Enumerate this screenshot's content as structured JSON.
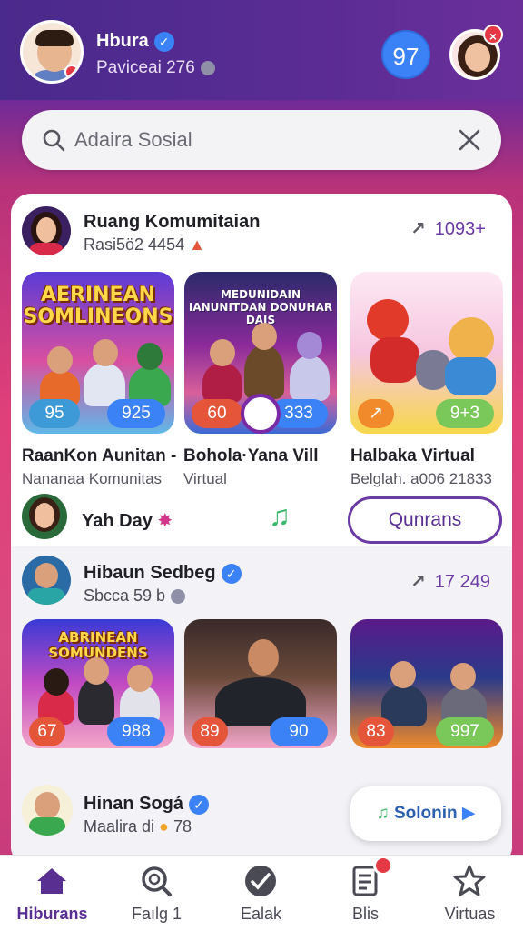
{
  "header": {
    "user_name": "Hbura",
    "user_sub": "Paviceai 276",
    "count_badge": "97"
  },
  "search": {
    "placeholder": "Adaira Sosial"
  },
  "group1": {
    "title": "Ruang Komumitaian",
    "sub": "Rasi5ö2 4454",
    "trend": "1093+",
    "tiles": [
      {
        "banner": "AERINEAN SOMLINEONS",
        "left_pill": "95",
        "right_pill": "925",
        "title": "RaanKon Aunitan -",
        "sub": "Nananaa Komunitas"
      },
      {
        "banner": "MEDUNIDAIN IANUNITDAN DONUHAR DAIS",
        "left_pill": "60",
        "right_pill": "333",
        "title": "Bohola·Yana Vill",
        "sub": "Virtual"
      },
      {
        "banner": "",
        "left_pill": "",
        "right_pill": "9+3",
        "title": "Halbaka Virtual",
        "sub": "Belglah. a006 21833"
      }
    ]
  },
  "row_yah": {
    "title": "Yah Day",
    "button": "Qunrans"
  },
  "group2": {
    "title": "Hibaun Sedbeg",
    "sub": "Sbcca 59 b",
    "trend": "17 249",
    "tiles": [
      {
        "banner": "ABRINEAN SOMUNDENS",
        "left_pill": "67",
        "right_pill": "988"
      },
      {
        "banner": "",
        "left_pill": "89",
        "right_pill": "90"
      },
      {
        "banner": "",
        "left_pill": "83",
        "right_pill": "997"
      }
    ]
  },
  "row_hinan": {
    "title": "Hinan Sogá",
    "sub": "Maalira di",
    "sub_tail": "78",
    "button": "Solonin"
  },
  "nav": [
    {
      "label": "Hiburans",
      "icon": "home-icon"
    },
    {
      "label": "Faılg 1",
      "icon": "search-icon"
    },
    {
      "label": "Ealak",
      "icon": "check-icon"
    },
    {
      "label": "Blis",
      "icon": "document-icon"
    },
    {
      "label": "Virtuas",
      "icon": "star-icon"
    }
  ],
  "colors": {
    "accent": "#5a2f92",
    "blue": "#3b82f6",
    "red": "#e53945"
  }
}
